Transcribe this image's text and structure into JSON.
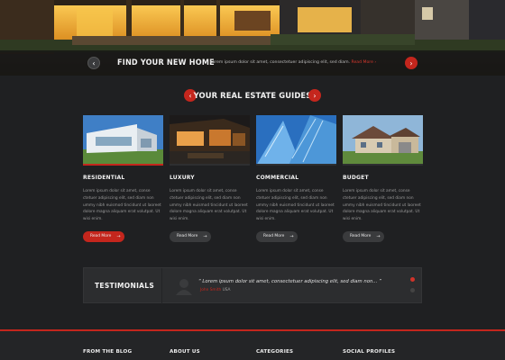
{
  "hero": {
    "title": "FIND YOUR NEW HOME",
    "text": "Lorem ipsum dolor sit amet, consectetuer adipiscing elit, sed diam.",
    "more": "Read More",
    "prev_icon": "chevron-left-icon",
    "next_icon": "chevron-right-icon"
  },
  "guides": {
    "title": "YOUR REAL ESTATE GUIDES",
    "cards": [
      {
        "title": "RESIDENTIAL",
        "text": "Lorem ipsum dolor sit amet, conse ctetuer adipiscing elit, sed diam non ummy nibh euismod tincidunt ut laoreet dolore magna aliquam erat volutpat. Ut wisi enim.",
        "button": "Read More"
      },
      {
        "title": "LUXURY",
        "text": "Lorem ipsum dolor sit amet, conse ctetuer adipiscing elit, sed diam non ummy nibh euismod tincidunt ut laoreet dolore magna aliquam erat volutpat. Ut wisi enim.",
        "button": "Read More"
      },
      {
        "title": "COMMERCIAL",
        "text": "Lorem ipsum dolor sit amet, conse ctetuer adipiscing elit, sed diam non ummy nibh euismod tincidunt ut laoreet dolore magna aliquam erat volutpat. Ut wisi enim.",
        "button": "Read More"
      },
      {
        "title": "BUDGET",
        "text": "Lorem ipsum dolor sit amet, conse ctetuer adipiscing elit, sed diam non ummy nibh euismod tincidunt ut laoreet dolore magna aliquam erat volutpat. Ut wisi enim.",
        "button": "Read More"
      }
    ]
  },
  "testimonials": {
    "title": "TESTIMONIALS",
    "quote": "“ Lorem ipsum dolor sit amet, consectetuer adipiscing elit, sed diam non... ”",
    "author_name": "John Smith",
    "author_location": "USA"
  },
  "footer": {
    "columns": [
      "FROM THE BLOG",
      "ABOUT US",
      "CATEGORIES",
      "SOCIAL PROFILES"
    ]
  },
  "colors": {
    "accent": "#c4261d",
    "background": "#1f2022"
  }
}
